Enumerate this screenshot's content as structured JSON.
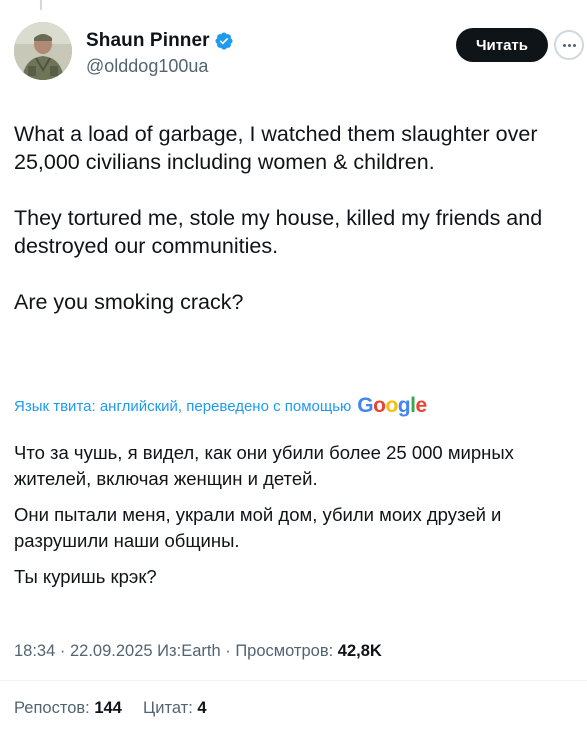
{
  "author": {
    "display_name": "Shaun Pinner",
    "handle": "@olddog100ua",
    "verified": true
  },
  "header": {
    "read_button_label": "Читать"
  },
  "tweet": {
    "paragraphs": [
      "What a load of garbage, I watched them slaughter over 25,000 civilians including women & children.",
      "They tortured me, stole my house, killed my friends and destroyed our communities.",
      "Are you smoking crack?"
    ]
  },
  "translation": {
    "notice": "Язык твита: английский, переведено с помощью",
    "provider": "Google",
    "paragraphs": [
      "Что за чушь, я видел, как они убили более 25 000 мирных жителей, включая женщин и детей.",
      "Они пытали меня, украли мой дом, убили моих друзей и разрушили наши общины.",
      "Ты куришь крэк?"
    ]
  },
  "meta": {
    "time": "18:34",
    "date": "22.09.2025",
    "source_prefix": "Из:",
    "source": "Earth",
    "views_label": "Просмотров:",
    "views_count": "42,8K"
  },
  "stats": {
    "reposts_label": "Репостов:",
    "reposts_count": "144",
    "quotes_label": "Цитат:",
    "quotes_count": "4"
  },
  "colors": {
    "accent": "#1d9bf0",
    "text_primary": "#0f1419",
    "text_secondary": "#536471"
  },
  "icons": [
    "avatar-photo",
    "verified-badge-icon",
    "more-icon"
  ]
}
